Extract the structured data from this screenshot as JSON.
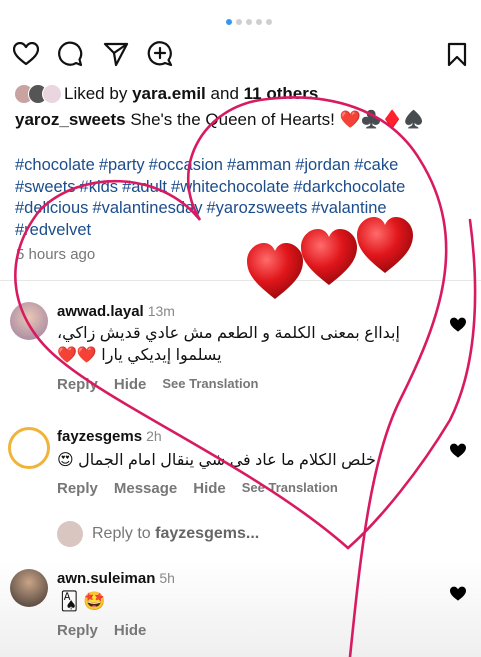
{
  "carousel": {
    "count": 5,
    "active": 0,
    "active_color": "#3797f0"
  },
  "post": {
    "liked_by_prefix": "Liked by",
    "liked_by_user": "yara.emil",
    "liked_by_and": "and",
    "liked_by_others": "11 others",
    "author": "yaroz_sweets",
    "caption": "She's the Queen of Hearts! ❤️♣️♦️♠️",
    "hashtags": [
      "#chocolate",
      "#party",
      "#occasion",
      "#amman",
      "#jordan",
      "#cake",
      "#sweets",
      "#kids",
      "#adult",
      "#whitechocolate",
      "#darkchocolate",
      "#delicious",
      "#valantinesday",
      "#yarozsweets",
      "#valantine",
      "#redvelvet"
    ],
    "time_ago": "5 hours ago"
  },
  "comments": [
    {
      "user": "awwad.layal",
      "time": "13m",
      "text_line1": "إبدااع بمعنى الكلمة و الطعم مش عادي قديش زاكي،",
      "text_line2": "يسلموا إيديكي يارا ❤️❤️",
      "reply": "Reply",
      "hide": "Hide",
      "see_translation": "See Translation"
    },
    {
      "user": "fayzesgems",
      "time": "2h",
      "text_line1": "خلص الكلام ما عاد في شي ينقال امام الجمال 😍",
      "reply": "Reply",
      "message": "Message",
      "hide": "Hide",
      "see_translation": "See Translation"
    },
    {
      "user": "awn.suleiman",
      "time": "5h",
      "text_line1": "🂡 🤩",
      "reply": "Reply",
      "hide": "Hide"
    }
  ],
  "reply_to": {
    "prefix": "Reply to",
    "user": "fayzesgems..."
  },
  "icons": [
    "heart-icon",
    "comment-icon",
    "share-icon",
    "remix-icon",
    "bookmark-icon"
  ],
  "colors": {
    "hashtag": "#1c4d8c",
    "sticker": "#d81b60",
    "heart": "#e0161b"
  }
}
